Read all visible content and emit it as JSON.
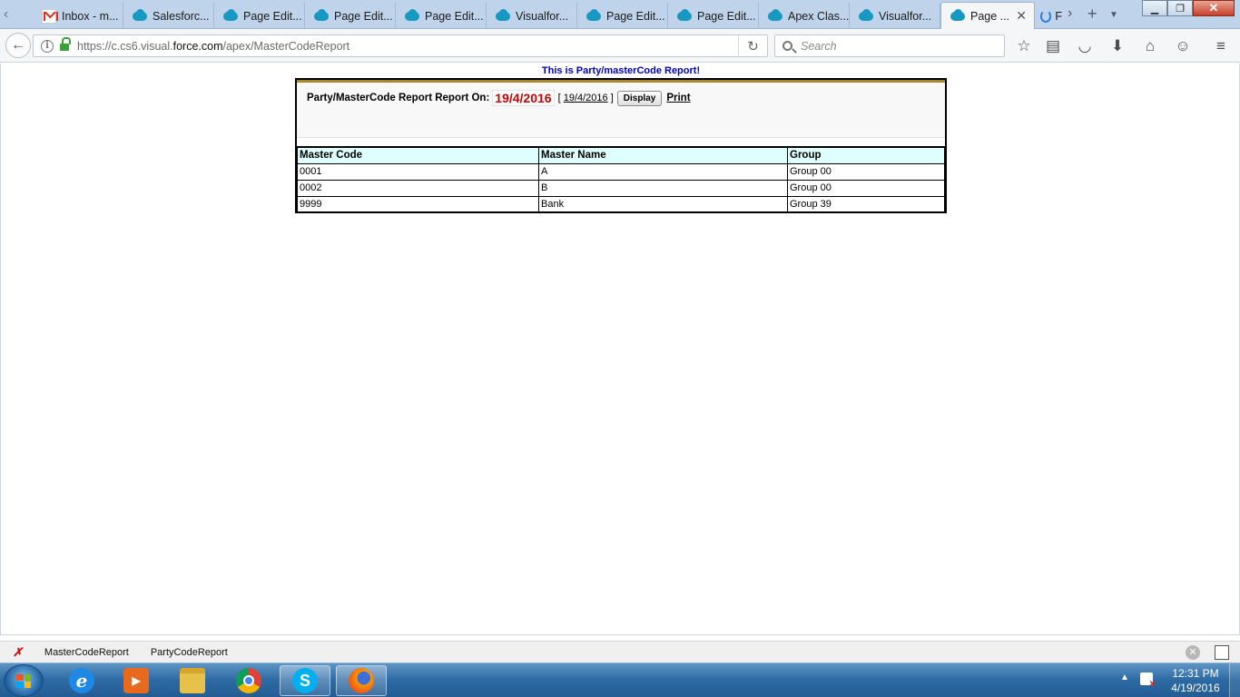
{
  "browser": {
    "tabs": [
      {
        "label": "Inbox - m...",
        "icon": "gmail-icon"
      },
      {
        "label": "Salesforc...",
        "icon": "salesforce-cloud-icon"
      },
      {
        "label": "Page Edit...",
        "icon": "salesforce-cloud-icon"
      },
      {
        "label": "Page Edit...",
        "icon": "salesforce-cloud-icon"
      },
      {
        "label": "Page Edit...",
        "icon": "salesforce-cloud-icon"
      },
      {
        "label": "Visualfor...",
        "icon": "salesforce-cloud-icon"
      },
      {
        "label": "Page Edit...",
        "icon": "salesforce-cloud-icon"
      },
      {
        "label": "Page Edit...",
        "icon": "salesforce-cloud-icon"
      },
      {
        "label": "Apex Clas...",
        "icon": "salesforce-cloud-icon"
      },
      {
        "label": "Visualfor...",
        "icon": "salesforce-cloud-icon"
      }
    ],
    "active_tab": {
      "label": "Page ...",
      "icon": "salesforce-cloud-icon"
    },
    "loading_tab_letter": "F",
    "url_prefix": "https://c.cs6.visual.",
    "url_host": "force.com",
    "url_path": "/apex/MasterCodeReport",
    "search_placeholder": "Search"
  },
  "report": {
    "heading": "This is Party/masterCode Report!",
    "report_on_label": "Party/MasterCode Report Report On:",
    "selected_date": "19/4/2016",
    "date_link_open": "[",
    "date_link": "19/4/2016",
    "date_link_close": "]",
    "display_button": "Display",
    "print_link": "Print",
    "columns": [
      "Master Code",
      "Master Name",
      "Group"
    ],
    "rows": [
      {
        "code": "0001",
        "name": "A",
        "group": "Group 00"
      },
      {
        "code": "0002",
        "name": "B",
        "group": "Group 00"
      },
      {
        "code": "9999",
        "name": "Bank",
        "group": "Group 39"
      }
    ]
  },
  "bookmarks": {
    "items": [
      "MasterCodeReport",
      "PartyCodeReport"
    ]
  },
  "taskbar": {
    "apps": [
      "internet-explorer-icon",
      "media-player-icon",
      "file-explorer-icon",
      "chrome-icon",
      "skype-icon",
      "firefox-icon"
    ],
    "clock_time": "12:31 PM",
    "clock_date": "4/19/2016"
  }
}
